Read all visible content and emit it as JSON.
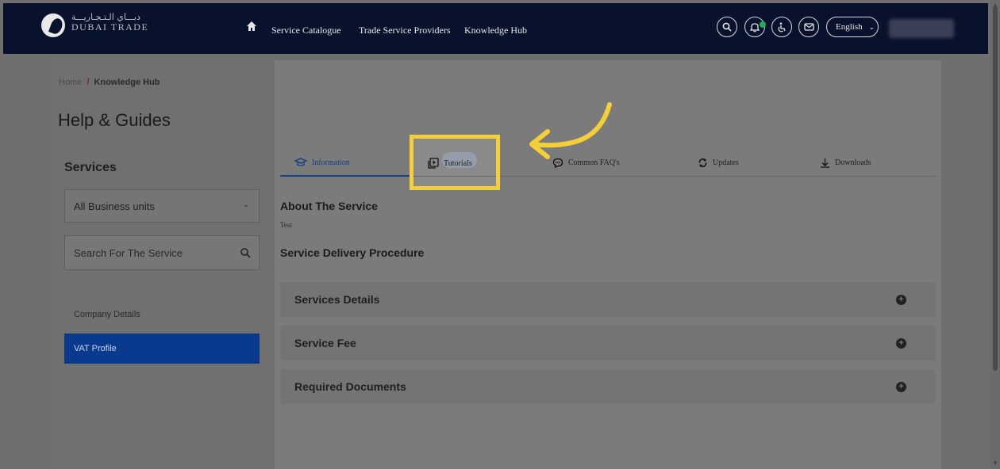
{
  "header": {
    "logo_arabic": "دبـــاي الـتـجـاريـــة",
    "logo_text": "DUBAI TRADE",
    "nav": [
      "Service Catalogue",
      "Trade Service Providers",
      "Knowledge Hub"
    ],
    "language": "English"
  },
  "breadcrumb": {
    "home": "Home",
    "separator": "/",
    "current": "Knowledge Hub"
  },
  "page_title": "Help & Guides",
  "sidebar": {
    "title": "Services",
    "select_value": "All Business units",
    "search_placeholder": "Search For The Service",
    "items": [
      "Company Details",
      "VAT Profile"
    ]
  },
  "tabs": [
    {
      "label": "Information",
      "icon": "graduation-cap-icon"
    },
    {
      "label": "Tutorials",
      "icon": "play-icon"
    },
    {
      "label": "Common FAQ's",
      "icon": "chat-icon"
    },
    {
      "label": "Updates",
      "icon": "refresh-icon"
    },
    {
      "label": "Downloads",
      "icon": "download-icon"
    }
  ],
  "content": {
    "about_title": "About The Service",
    "about_text": "Test",
    "procedure_title": "Service Delivery Procedure",
    "accordions": [
      "Services Details",
      "Service Fee",
      "Required Documents"
    ]
  },
  "colors": {
    "topbar": "#08122c",
    "active_item": "#093a8e",
    "highlight": "#f5cf3a"
  }
}
